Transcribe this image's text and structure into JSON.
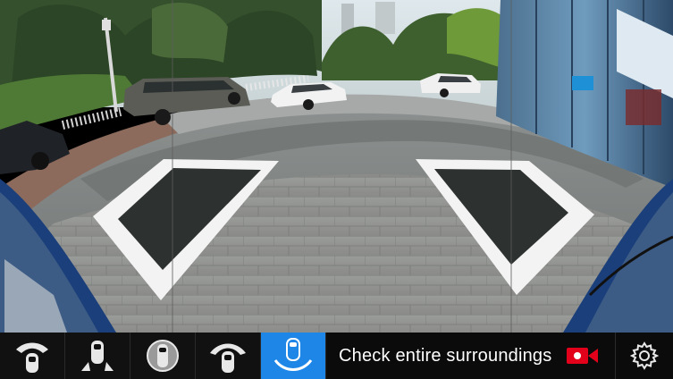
{
  "view_modes": [
    {
      "id": "front-view",
      "icon": "car-front-view-icon",
      "active": false
    },
    {
      "id": "rear-wheel-view",
      "icon": "car-rear-wheels-icon",
      "active": false
    },
    {
      "id": "360-view",
      "icon": "car-360-view-icon",
      "active": false
    },
    {
      "id": "front-wide-view",
      "icon": "car-front-wide-view-icon",
      "active": false
    },
    {
      "id": "rear-wide-view",
      "icon": "car-rear-wide-view-icon",
      "active": true
    }
  ],
  "status": {
    "message": "Check entire surroundings",
    "record_icon": "video-record-icon",
    "record_color": "#e3001b"
  },
  "settings": {
    "icon": "gear-icon"
  },
  "colors": {
    "accent": "#1e86e6",
    "bar_background": "#0b0b0b"
  }
}
